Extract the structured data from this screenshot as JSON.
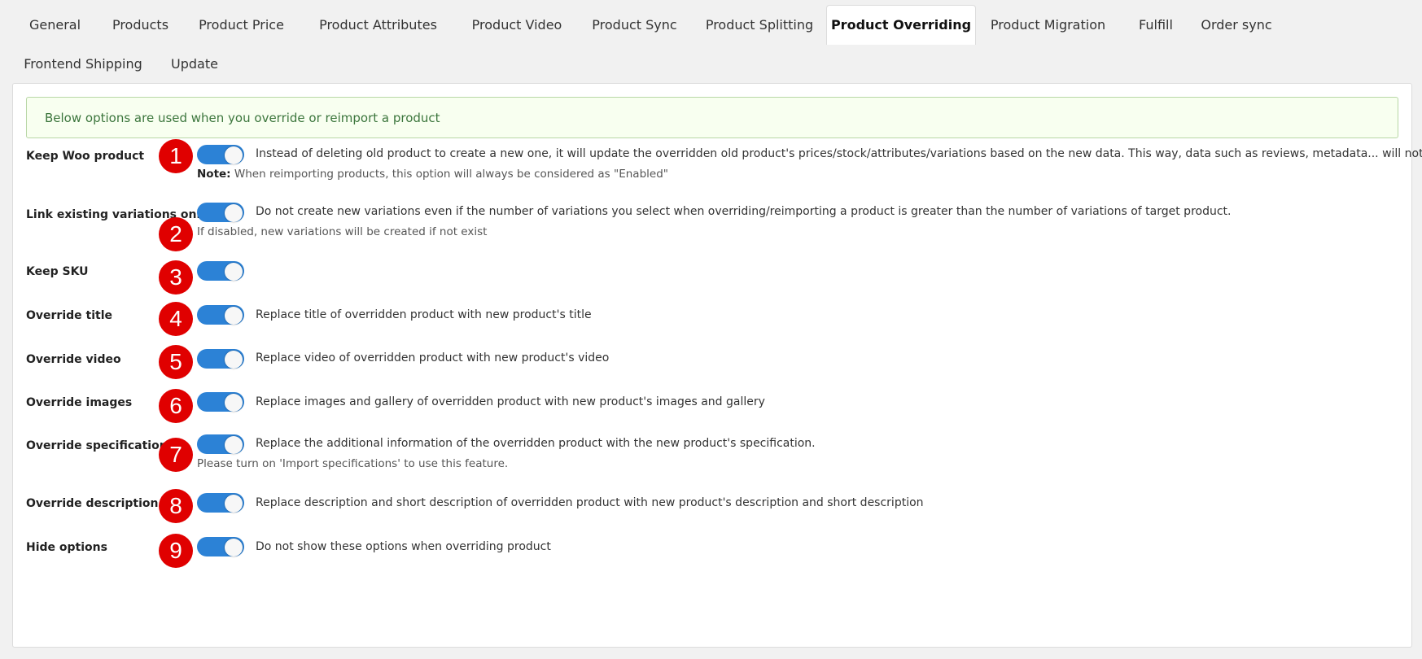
{
  "tabs": {
    "items": [
      {
        "label": "General",
        "active": false
      },
      {
        "label": "Products",
        "active": false
      },
      {
        "label": "Product Price",
        "active": false
      },
      {
        "label": "Product Attributes",
        "active": false
      },
      {
        "label": "Product Video",
        "active": false
      },
      {
        "label": "Product Sync",
        "active": false
      },
      {
        "label": "Product Splitting",
        "active": false
      },
      {
        "label": "Product Overriding",
        "active": true
      },
      {
        "label": "Product Migration",
        "active": false
      },
      {
        "label": "Fulfill",
        "active": false
      },
      {
        "label": "Order sync",
        "active": false
      },
      {
        "label": "Frontend Shipping",
        "active": false
      },
      {
        "label": "Update",
        "active": false
      }
    ]
  },
  "notice": {
    "text": "Below options are used when you override or reimport a product"
  },
  "options": [
    {
      "marker": "1",
      "label": "Keep Woo product",
      "enabled": true,
      "description": "Instead of deleting old product to create a new one, it will update the overridden old product's prices/stock/attributes/variations based on the new data. This way, data such as reviews, metadata... will not be lost.",
      "note_prefix": "Note:",
      "note": " When reimporting products, this option will always be considered as \"Enabled\""
    },
    {
      "marker": "2",
      "label": "Link existing variations only",
      "enabled": true,
      "description": "Do not create new variations even if the number of variations you select when overriding/reimporting a product is greater than the number of variations of target product.",
      "note": "If disabled, new variations will be created if not exist"
    },
    {
      "marker": "3",
      "label": "Keep SKU",
      "enabled": true
    },
    {
      "marker": "4",
      "label": "Override title",
      "enabled": true,
      "description": "Replace title of overridden product with new product's title"
    },
    {
      "marker": "5",
      "label": "Override video",
      "enabled": true,
      "description": "Replace video of overridden product with new product's video"
    },
    {
      "marker": "6",
      "label": "Override images",
      "enabled": true,
      "description": "Replace images and gallery of overridden product with new product's images and gallery"
    },
    {
      "marker": "7",
      "label": "Override specifications",
      "enabled": true,
      "description": "Replace the additional information of the overridden product with the new product's specification.",
      "note": "Please turn on 'Import specifications' to use this feature."
    },
    {
      "marker": "8",
      "label": "Override description",
      "enabled": true,
      "description": "Replace description and short description of overridden product with new product's description and short description"
    },
    {
      "marker": "9",
      "label": "Hide options",
      "enabled": true,
      "description": "Do not show these options when overriding product"
    }
  ],
  "colors": {
    "toggle_on": "#2c82d6",
    "marker": "#e00000",
    "notice_bg": "#f8fff0",
    "notice_text": "#3c763d"
  }
}
